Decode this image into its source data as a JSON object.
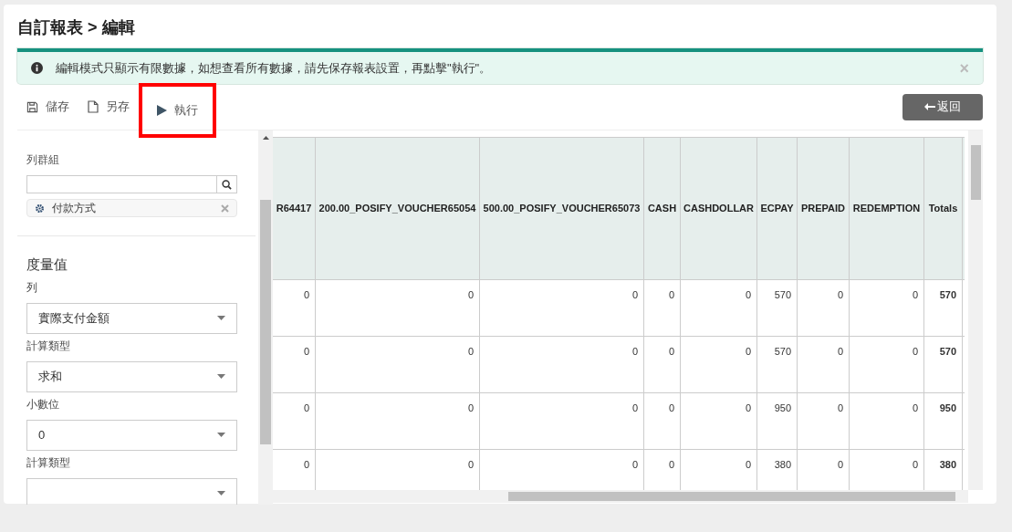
{
  "title": "自訂報表 > 編輯",
  "alert": {
    "text": "編輯模式只顯示有限數據，如想查看所有數據，請先保存報表設置，再點擊\"執行\"。",
    "close": "×"
  },
  "toolbar": [
    {
      "kind": "save",
      "label": "儲存",
      "highlighted": false
    },
    {
      "kind": "saveas",
      "label": "另存",
      "highlighted": false
    },
    {
      "kind": "run",
      "label": "執行",
      "highlighted": true
    }
  ],
  "back_button": "返回",
  "sidebar": {
    "column_group_label": "列群組",
    "column_group_chips": [
      {
        "label": "付款方式"
      }
    ],
    "measures_title": "度量值",
    "fields": [
      {
        "label": "列",
        "value": "實際支付金額"
      },
      {
        "label": "計算類型",
        "value": "求和"
      },
      {
        "label": "小數位",
        "value": "0"
      },
      {
        "label": "計算類型"
      }
    ]
  },
  "table": {
    "columns": [
      "R64417",
      "200.00_POSIFY_VOUCHER65054",
      "500.00_POSIFY_VOUCHER65073",
      "CASH",
      "CASHDOLLAR",
      "ECPAY",
      "PREPAID",
      "REDEMPTION",
      "Totals"
    ],
    "rows": [
      [
        "0",
        "0",
        "0",
        "0",
        "0",
        "570",
        "0",
        "0",
        "570"
      ],
      [
        "0",
        "0",
        "0",
        "0",
        "0",
        "570",
        "0",
        "0",
        "570"
      ],
      [
        "0",
        "0",
        "0",
        "0",
        "0",
        "950",
        "0",
        "0",
        "950"
      ],
      [
        "0",
        "0",
        "0",
        "0",
        "0",
        "380",
        "0",
        "0",
        "380"
      ]
    ]
  }
}
